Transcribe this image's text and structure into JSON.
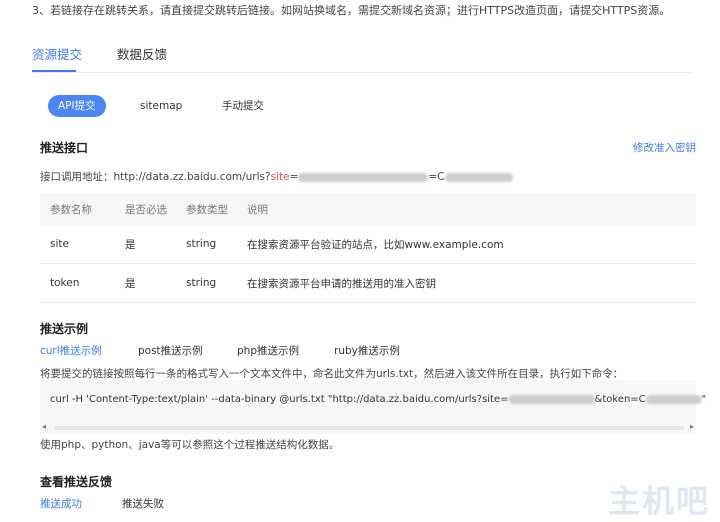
{
  "note": "3、若链接存在跳转关系，请直接提交跳转后链接。如网站换域名，需提交新域名资源；进行HTTPS改造页面，请提交HTTPS资源。",
  "tabs": {
    "resource_submit": "资源提交",
    "data_feedback": "数据反馈"
  },
  "subtabs": {
    "api": "API提交",
    "sitemap": "sitemap",
    "manual": "手动提交"
  },
  "push_api": {
    "title": "推送接口",
    "modify_link": "修改准入密钥",
    "url_label": "接口调用地址：",
    "url_prefix": "http://data.zz.baidu.com/urls?",
    "url_site_key": "site",
    "url_eq": "=",
    "url_token_part": "=C"
  },
  "params_table": {
    "headers": [
      "参数名称",
      "是否必选",
      "参数类型",
      "说明"
    ],
    "rows": [
      [
        "site",
        "是",
        "string",
        "在搜索资源平台验证的站点，比如www.example.com"
      ],
      [
        "token",
        "是",
        "string",
        "在搜索资源平台申请的推送用的准入密钥"
      ]
    ]
  },
  "examples": {
    "title": "推送示例",
    "tabs": [
      "curl推送示例",
      "post推送示例",
      "php推送示例",
      "ruby推送示例"
    ],
    "instruction": "将要提交的链接按照每行一条的格式写入一个文本文件中，命名此文件为urls.txt，然后进入该文件所在目录，执行如下命令：",
    "code_prefix": "curl -H 'Content-Type:text/plain' --data-binary @urls.txt \"http://data.zz.baidu.com/urls?site=",
    "code_mid": "&token=C",
    "code_end": "\"",
    "footer": "使用php、python、java等可以参照这个过程推送结构化数据。"
  },
  "feedback": {
    "title": "查看推送反馈",
    "tabs": [
      "推送成功",
      "推送失败"
    ]
  },
  "watermark": "主机吧",
  "colors": {
    "accent": "#3a7af7",
    "pill": "#4c86f5",
    "highlight": "#e2545a"
  }
}
